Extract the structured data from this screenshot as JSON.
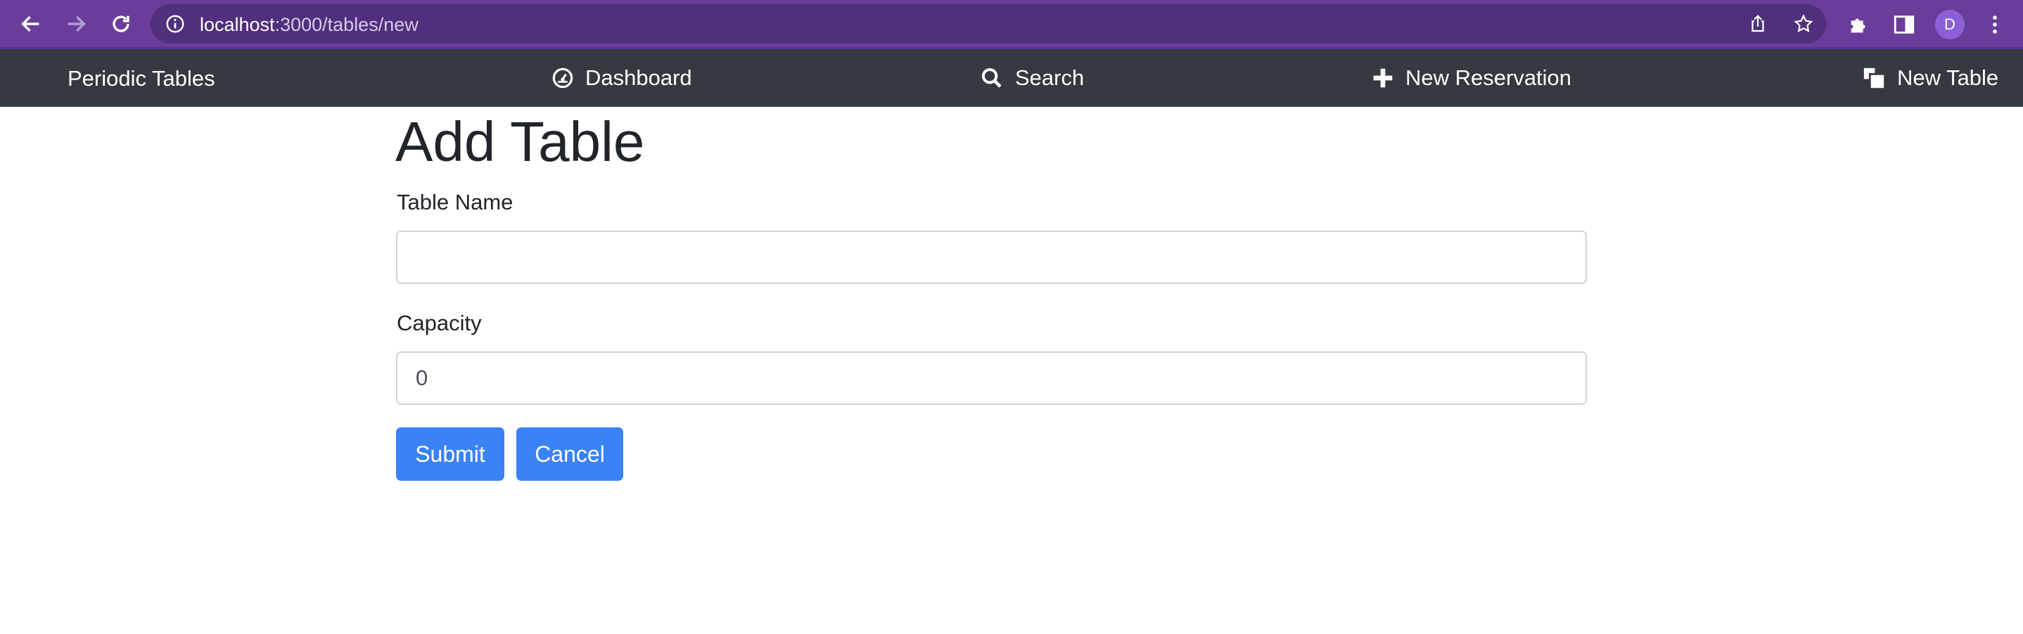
{
  "browser": {
    "url_host": "localhost",
    "url_path": ":3000/tables/new",
    "profile_initial": "D",
    "icons": {
      "back": "arrow-left-icon",
      "forward": "arrow-right-icon",
      "reload": "reload-icon",
      "site_info": "info-icon",
      "share": "share-icon",
      "bookmark": "star-icon",
      "extensions": "puzzle-icon",
      "side_panel": "side-panel-icon",
      "menu": "kebab-menu-icon"
    }
  },
  "navbar": {
    "brand": "Periodic Tables",
    "links": [
      {
        "label": "Dashboard",
        "icon": "dashboard-gauge-icon"
      },
      {
        "label": "Search",
        "icon": "search-icon"
      },
      {
        "label": "New Reservation",
        "icon": "plus-icon"
      },
      {
        "label": "New Table",
        "icon": "layers-icon"
      }
    ]
  },
  "form": {
    "title": "Add Table",
    "table_name": {
      "label": "Table Name",
      "value": ""
    },
    "capacity": {
      "label": "Capacity",
      "value": "0"
    },
    "submit_label": "Submit",
    "cancel_label": "Cancel"
  },
  "colors": {
    "chrome": "#6a3d9a",
    "omnibox": "#50307c",
    "navbar": "#343a40",
    "primary_button": "#3b82f6"
  }
}
